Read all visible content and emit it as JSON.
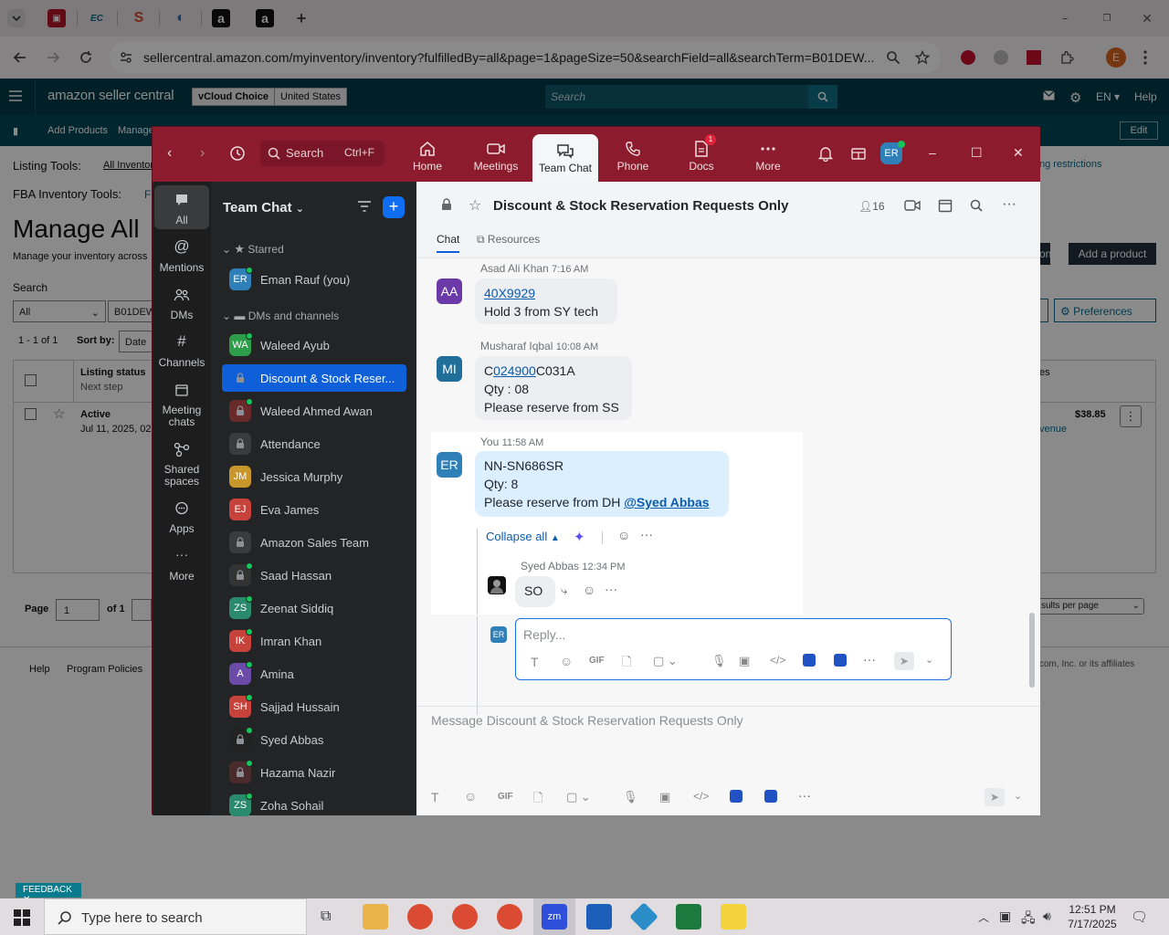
{
  "browser": {
    "url": "sellercentral.amazon.com/myinventory/inventory?fulfilledBy=all&page=1&pageSize=50&searchField=all&searchTerm=B01DEW...",
    "profile_initial": "E"
  },
  "amazon": {
    "logo": "amazon seller central",
    "store": "vCloud Choice",
    "region": "United States",
    "search_placeholder": "Search",
    "lang": "EN",
    "help": "Help",
    "nav": [
      "Add Products",
      "Manage"
    ],
    "edit": "Edit",
    "listing_tools": "Listing Tools:",
    "all_inventory": "All Inventory",
    "fba_tools": "FBA Inventory Tools:",
    "fba_link": "F",
    "restrictions": "ng restrictions",
    "title": "Manage All",
    "subtitle": "Manage your inventory across",
    "search_label": "Search",
    "filter_all": "All",
    "search_term": "B01DEW",
    "range": "1 - 1 of 1",
    "sort_by": "Sort by:",
    "sort_value": "Date",
    "col_status": "Listing status",
    "col_next": "Next step",
    "row_status": "Active",
    "row_date": "Jul 11, 2025, 02",
    "price": "$38.85",
    "revenue": "venue",
    "btn_add_product": "Add a product",
    "btn_on": "on",
    "btn_preferences": "Preferences",
    "col_es": "es",
    "page_label": "Page",
    "page_value": "1",
    "of_label": "of 1",
    "per_page": "sults per page",
    "footer_help": "Help",
    "footer_policies": "Program Policies",
    "footer_copy": "com, Inc. or its affiliates",
    "feedback": "FEEDBACK"
  },
  "zoom": {
    "search": "Search",
    "search_shortcut": "Ctrl+F",
    "nav": [
      {
        "label": "Home"
      },
      {
        "label": "Meetings"
      },
      {
        "label": "Team Chat"
      },
      {
        "label": "Phone"
      },
      {
        "label": "Docs",
        "badge": "1"
      },
      {
        "label": "More"
      }
    ],
    "user_initials": "ER",
    "rail": [
      {
        "label": "All"
      },
      {
        "label": "Mentions"
      },
      {
        "label": "DMs"
      },
      {
        "label": "Channels"
      },
      {
        "label": "Meeting chats"
      },
      {
        "label": "Shared spaces"
      },
      {
        "label": "Apps"
      },
      {
        "label": "More"
      }
    ],
    "list_title": "Team Chat",
    "starred": "Starred",
    "dms_channels": "DMs and channels",
    "contacts": [
      {
        "name": "Eman Rauf (you)",
        "initials": "ER",
        "color": "#2f7fb8"
      },
      {
        "name": "Waleed Ayub",
        "initials": "WA",
        "color": "#2e9d4a"
      },
      {
        "name": "Discount & Stock Reser...",
        "initials": "",
        "color": "#0e5fd8"
      },
      {
        "name": "Waleed Ahmed Awan",
        "initials": "",
        "color": "#6a2a2a"
      },
      {
        "name": "Attendance",
        "initials": "",
        "color": "#3a3b3d"
      },
      {
        "name": "Jessica Murphy",
        "initials": "JM",
        "color": "#c9962b"
      },
      {
        "name": "Eva James",
        "initials": "EJ",
        "color": "#c7423a"
      },
      {
        "name": "Amazon Sales Team",
        "initials": "",
        "color": "#3a3b3d"
      },
      {
        "name": "Saad Hassan",
        "initials": "",
        "color": "#333"
      },
      {
        "name": "Zeenat Siddiq",
        "initials": "ZS",
        "color": "#2a8a6c"
      },
      {
        "name": "Imran Khan",
        "initials": "IK",
        "color": "#c7423a"
      },
      {
        "name": "Amina",
        "initials": "A",
        "color": "#6b4aa8"
      },
      {
        "name": "Sajjad Hussain",
        "initials": "SH",
        "color": "#c7423a"
      },
      {
        "name": "Syed Abbas",
        "initials": "",
        "color": "#222"
      },
      {
        "name": "Hazama Nazir",
        "initials": "",
        "color": "#4a2a2a"
      },
      {
        "name": "Zoha Sohail",
        "initials": "ZS",
        "color": "#2a8a6c"
      }
    ],
    "channel": {
      "title": "Discount & Stock Reservation Requests Only",
      "members": "16",
      "tab_chat": "Chat",
      "tab_resources": "Resources"
    },
    "messages": [
      {
        "sender": "Asad Ali Khan",
        "time": "7:16 AM",
        "initials": "AA",
        "link": "40X9929",
        "lines": [
          "Hold 3 from SY tech"
        ]
      },
      {
        "sender": "Musharaf Iqbal",
        "time": "10:08 AM",
        "initials": "MI",
        "pre": "C",
        "link": "024900",
        "post": "C031A",
        "lines": [
          "Qty : 08",
          "Please reserve from SS"
        ]
      },
      {
        "sender": "You",
        "time": "11:58 AM",
        "initials": "ER",
        "lines": [
          "NN-SN686SR",
          "Qty: 8",
          "Please reserve from DH "
        ],
        "mention": "@Syed Abbas"
      }
    ],
    "collapse_all": "Collapse all",
    "reply": {
      "sender": "Syed Abbas",
      "time": "12:34 PM",
      "text": "SO"
    },
    "reply_placeholder": "Reply...",
    "composer_placeholder": "Message Discount & Stock Reservation Requests Only",
    "gif": "GIF"
  },
  "taskbar": {
    "search": "Type here to search",
    "time": "12:51 PM",
    "date": "7/17/2025"
  }
}
